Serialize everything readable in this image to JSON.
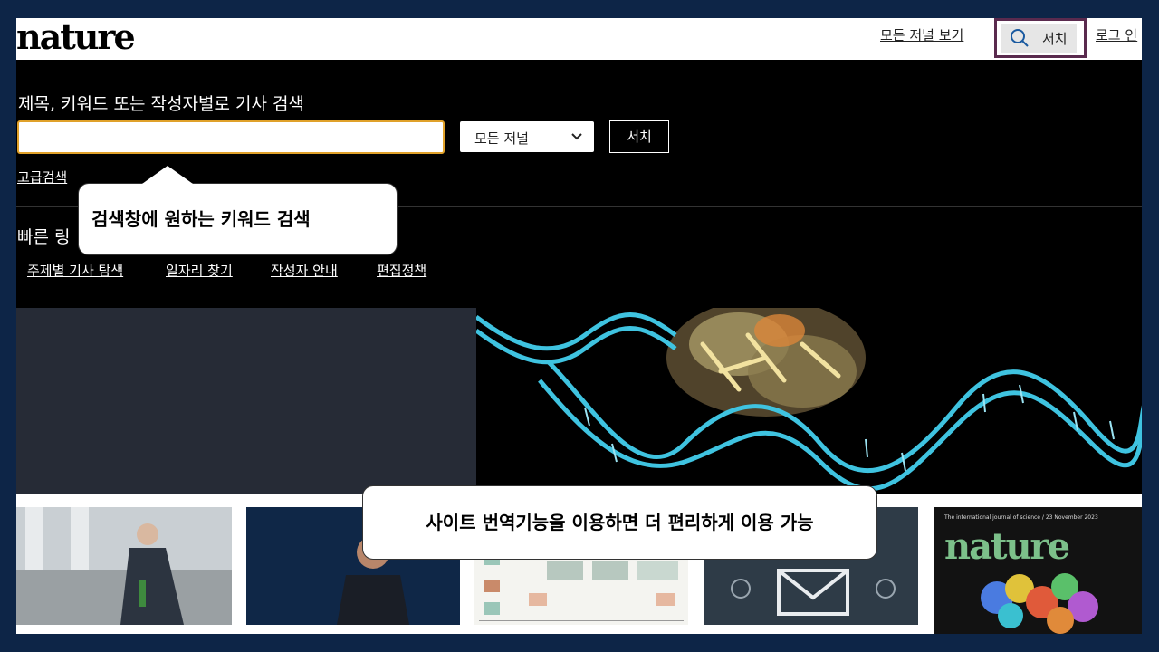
{
  "header": {
    "logo": "nature",
    "all_journals": "모든 저널 보기",
    "search_label": "서치",
    "login": "로그 인"
  },
  "search": {
    "heading": "제목, 키워드 또는 작성자별로 기사 검색",
    "input_value": "",
    "journal_select": "모든 저널",
    "button": "서치",
    "advanced": "고급검색"
  },
  "quick_links": {
    "title": "빠른 링",
    "items": [
      "주제별 기사 탐색",
      "일자리 찾기",
      "작성자 안내",
      "편집정책"
    ]
  },
  "callouts": {
    "search_tip": "검색창에 원하는 키워드 검색",
    "translate_tip": "사이트 번역기능을 이용하면 더 편리하게 이용 가능"
  },
  "cover": {
    "subtitle": "The international journal of science / 23 November 2023",
    "title": "nature"
  },
  "colors": {
    "frame_bg": "#0d2547",
    "search_border": "#e0a12a",
    "search_tab_border": "#5a2a4e",
    "dna": "#3fc3e0"
  }
}
